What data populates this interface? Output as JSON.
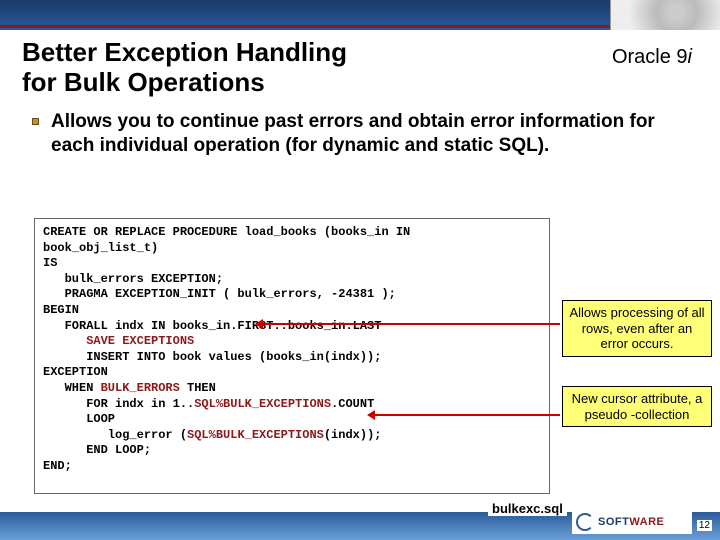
{
  "header": {
    "title_line1": "Better Exception Handling",
    "title_line2": "for Bulk Operations",
    "version_prefix": "Oracle 9",
    "version_suffix": "i"
  },
  "bullet": {
    "text": "Allows you to continue past errors and obtain error information for each individual operation (for dynamic and static SQL)."
  },
  "code": {
    "l01": "CREATE OR REPLACE PROCEDURE load_books (books_in IN",
    "l02": "book_obj_list_t)",
    "l03": "IS",
    "l04": "   bulk_errors EXCEPTION;",
    "l05": "   PRAGMA EXCEPTION_INIT ( bulk_errors, -24381 );",
    "l06": "BEGIN",
    "l07a": "   FORALL indx IN books_in.FIRST..books_in.LAST",
    "l08": "      SAVE EXCEPTIONS",
    "l09": "      INSERT INTO book values (books_in(indx));",
    "l10": "EXCEPTION",
    "l11a": "   WHEN ",
    "l11b": "BULK_ERRORS",
    "l11c": " THEN",
    "l12a": "      FOR indx in 1..",
    "l12b": "SQL%BULK_EXCEPTIONS",
    "l12c": ".COUNT",
    "l13": "      LOOP",
    "l14a": "         log_error (",
    "l14b": "SQL%BULK_EXCEPTIONS",
    "l14c": "(indx));",
    "l15": "      END LOOP;",
    "l16": "END;"
  },
  "callouts": {
    "c1": "Allows processing of all rows, even after an error occurs.",
    "c2": "New cursor attribute, a pseudo -collection"
  },
  "footer": {
    "filename": "bulkexc.sql",
    "page": "12",
    "logo_text_a": "SOFT",
    "logo_text_b": "WARE"
  }
}
